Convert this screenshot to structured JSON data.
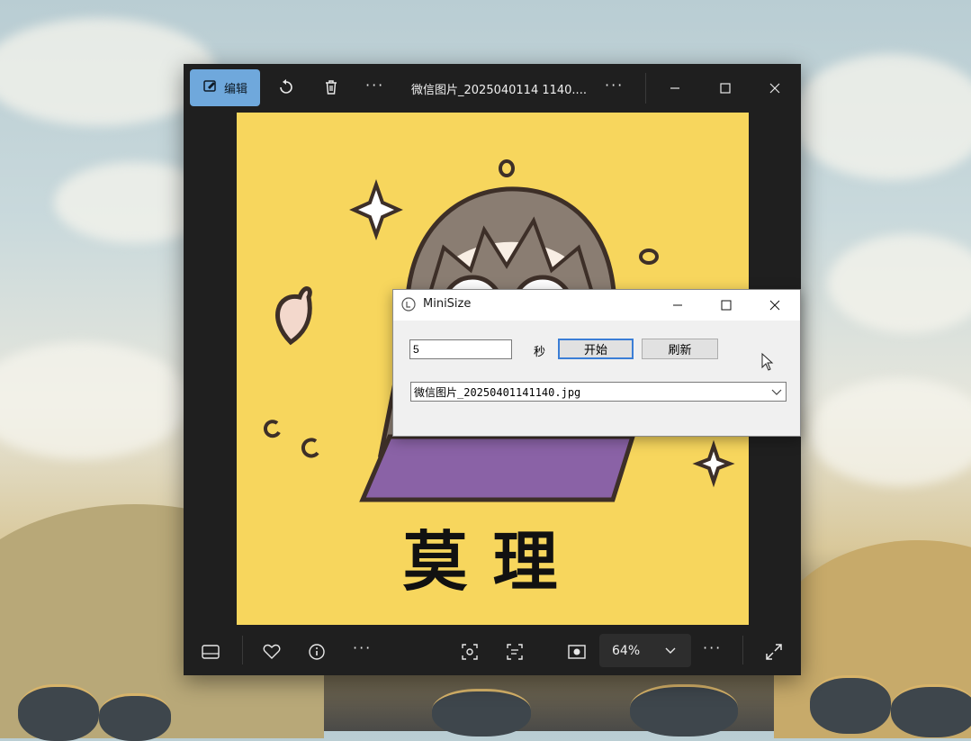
{
  "viewer": {
    "edit_label": "编辑",
    "title": "微信图片_2025040114 1140....",
    "zoom": "64%"
  },
  "photo": {
    "caption": "莫理"
  },
  "minisize": {
    "title": "MiniSize",
    "seconds_value": "5",
    "seconds_unit": "秒",
    "start_label": "开始",
    "refresh_label": "刷新",
    "selected_file": "微信图片_20250401141140.jpg"
  },
  "colors": {
    "accent": "#6fa8dc",
    "photo_bg": "#f7d65d",
    "viewer_bg": "#1f1f1f"
  }
}
